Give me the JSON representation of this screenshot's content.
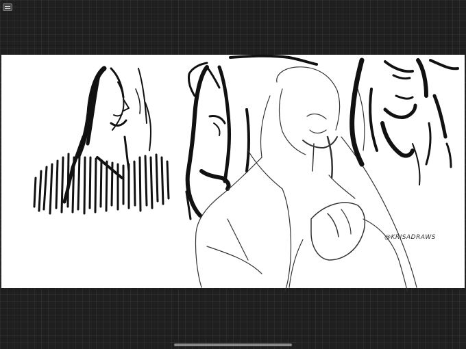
{
  "app": {
    "menu_icon": "sidebar-menu-icon",
    "background_color": "#1f1f1f",
    "canvas_color": "#ffffff"
  },
  "artwork": {
    "watermark": "@KRISADRAWS",
    "ink_color": "#111111"
  }
}
